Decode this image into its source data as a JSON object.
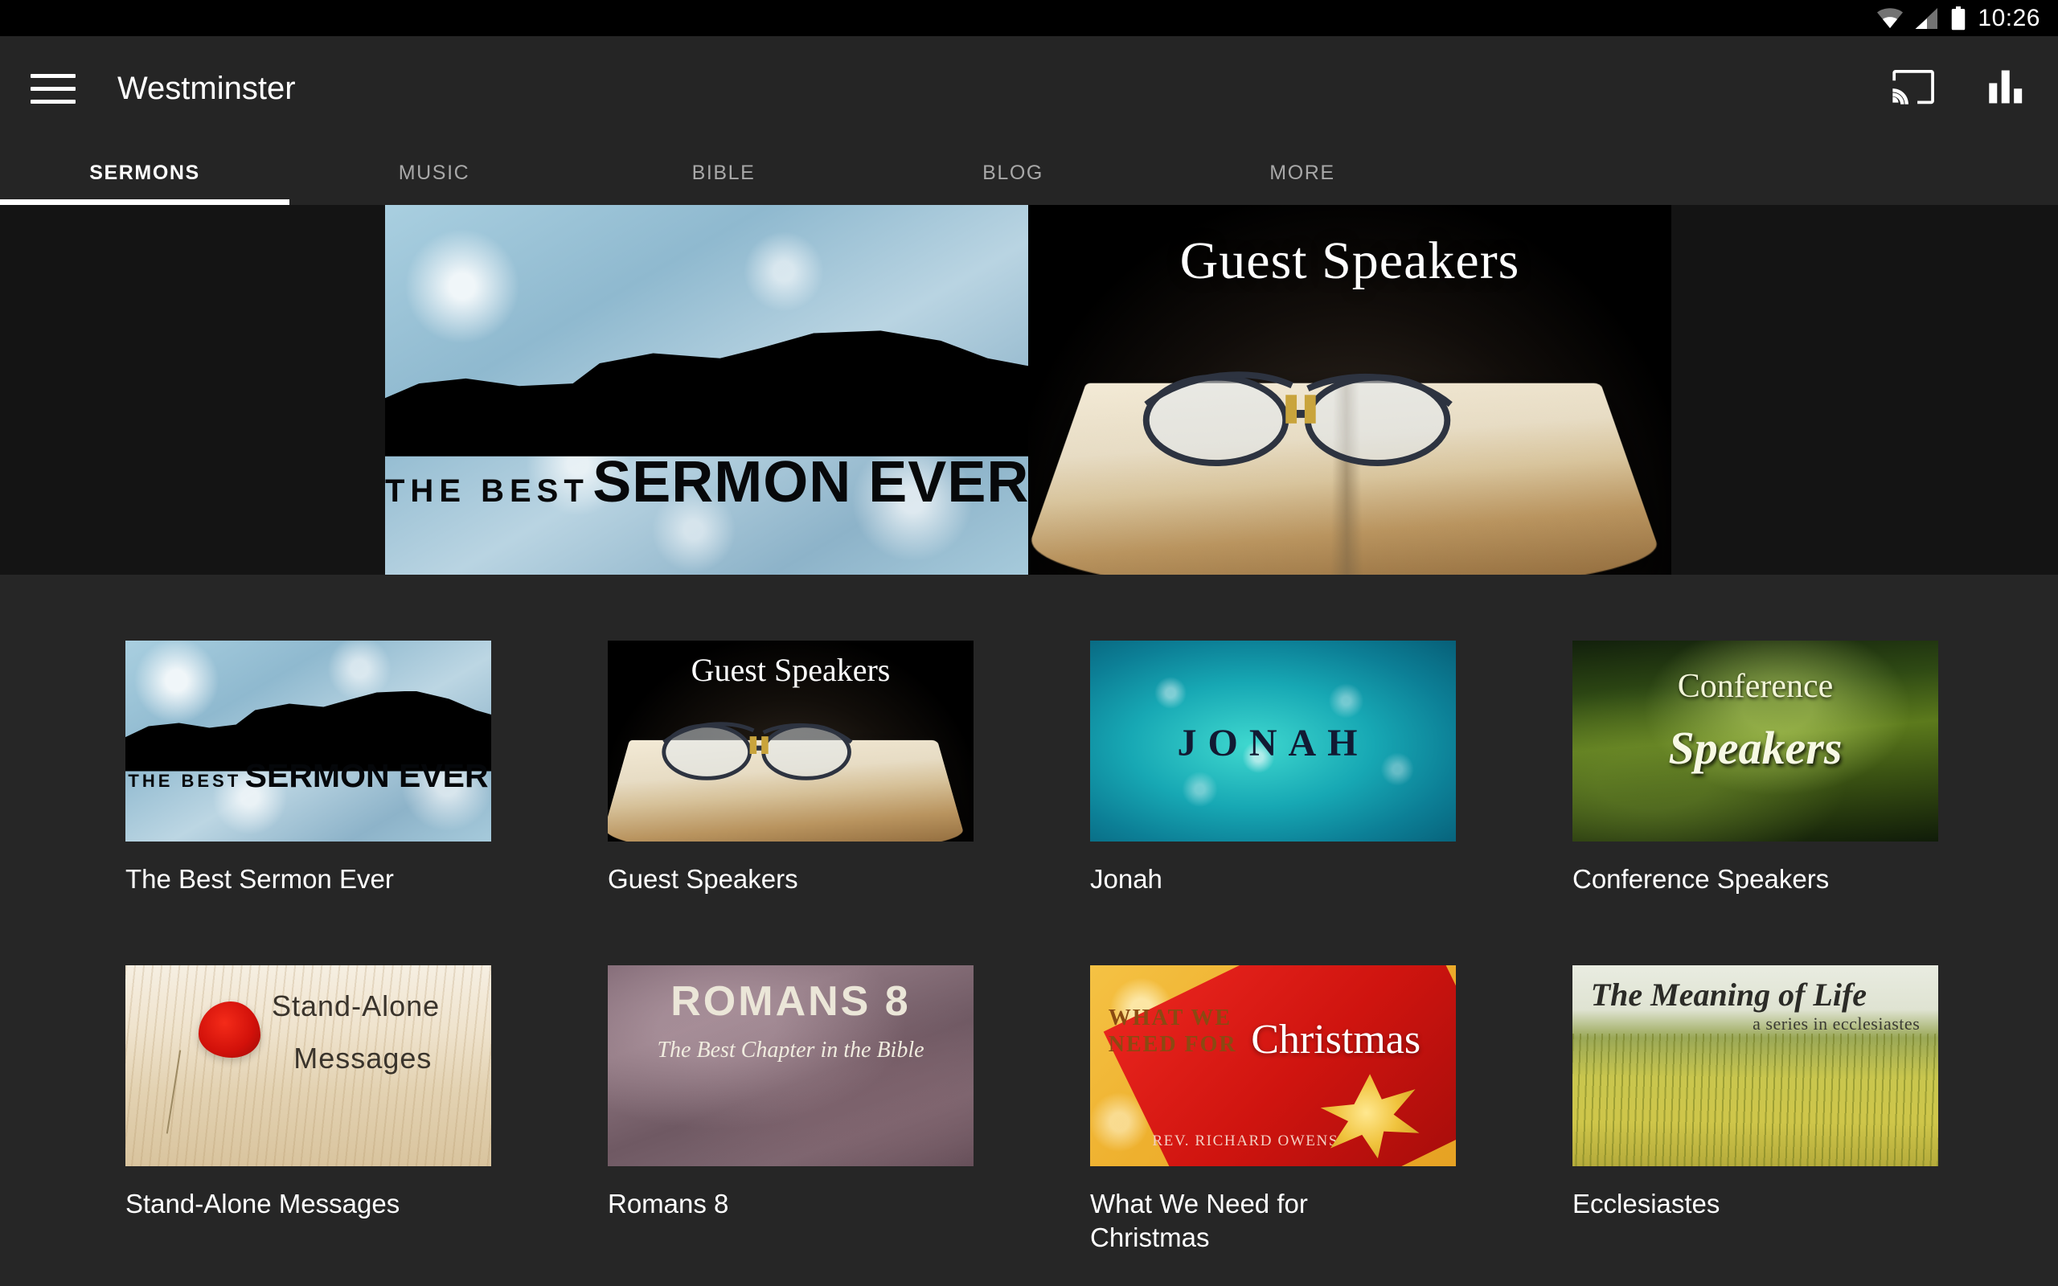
{
  "status_bar": {
    "wifi_icon": "wifi-icon",
    "signal_icon": "cellular-signal-icon",
    "battery_icon": "battery-icon",
    "clock": "10:26"
  },
  "app_bar": {
    "menu_icon": "hamburger-menu-icon",
    "title": "Westminster",
    "cast_icon": "chromecast-icon",
    "equalizer_icon": "equalizer-icon"
  },
  "tabs": [
    {
      "label": "SERMONS",
      "active": true
    },
    {
      "label": "MUSIC",
      "active": false
    },
    {
      "label": "BIBLE",
      "active": false
    },
    {
      "label": "BLOG",
      "active": false
    },
    {
      "label": "MORE",
      "active": false
    }
  ],
  "hero": {
    "slides": [
      {
        "name": "the-best-sermon-ever",
        "art_line_small": "THE BEST",
        "art_line_large": "SERMON EVER"
      },
      {
        "name": "guest-speakers",
        "art_title": "Guest Speakers"
      }
    ]
  },
  "series_grid": {
    "items": [
      {
        "label": "The Best Sermon Ever",
        "art_line_small": "THE BEST",
        "art_line_large": "SERMON EVER"
      },
      {
        "label": "Guest Speakers",
        "art_title": "Guest Speakers"
      },
      {
        "label": "Jonah",
        "art_title": "JONAH"
      },
      {
        "label": "Conference Speakers",
        "art_line_1": "Conference",
        "art_line_2": "Speakers"
      },
      {
        "label": "Stand-Alone Messages",
        "art_line_1": "Stand-Alone",
        "art_line_2": "Messages"
      },
      {
        "label": "Romans 8",
        "art_title": "ROMANS 8",
        "art_subtitle": "The Best Chapter in the Bible"
      },
      {
        "label": "What We Need for Christmas",
        "art_line_1": "WHAT WE",
        "art_line_2": "NEED FOR",
        "art_title": "Christmas",
        "art_credit": "REV. RICHARD OWENS"
      },
      {
        "label": "Ecclesiastes",
        "art_title": "The Meaning of Life",
        "art_subtitle": "a series in ecclesiastes"
      }
    ]
  },
  "colors": {
    "app_background": "#262626",
    "app_bar": "#252525",
    "status_bar": "#000000",
    "accent": "#ffffff",
    "tab_inactive": "#a8a8a8"
  }
}
